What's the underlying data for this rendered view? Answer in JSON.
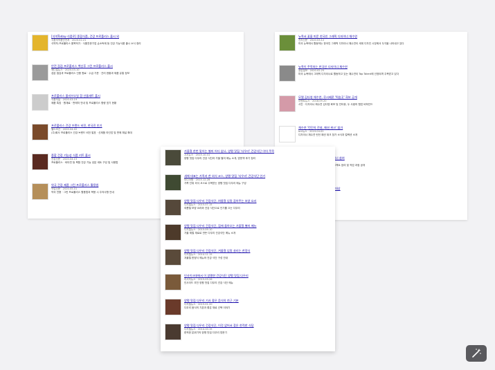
{
  "left": {
    "results": [
      {
        "title": "[식약Today-식품로] 종합식품, 건강 프로폴리스 출시 외",
        "meta": "식품의약품안전처 · 2020.02.21",
        "snip": "식약처-프로폴리스 품목허가 · 식품전문기업 손소독제 등 건강 기능식품 출시 소식 정리",
        "color": "#e4b52c"
      },
      {
        "title": "안전 점검 프로폴리스 백신후 그린 프로폴리스 출시",
        "meta": "메디컬뉴스 · 2020.03.10",
        "snip": "성분 점검과 프로폴리스 인증 원료 · 수급 기준 · 관리 현황과 제품 유통 정보",
        "color": "#9a9a9a"
      },
      {
        "title": "프로폴리스 올리브오일 함 선물세트 출시",
        "meta": "식품저널 · 2020.03.19",
        "snip": "제품 특징 · 원재료 · 판매처 안내 및 프로폴리스 함량 표기 현황",
        "color": "#cccccc"
      },
      {
        "title": "프로폴리스 건강 브랜드 비전, 한국진 인기",
        "meta": "헬스조선 · 2020.04.02",
        "snip": "(주)회사 프로폴리스 건강 브랜드 비전 발표 · 신제품 라인업 및 판매 채널 확대",
        "color": "#7a4a2a"
      },
      {
        "title": "종합 건강 기능성 식품 키트 출시",
        "meta": "건강신문 · 2020.04.15",
        "snip": "프로폴리스 · 비타민 등 복합 건강 기능 성분 세트 구성 및 사용법",
        "color": "#5a2a20"
      },
      {
        "title": "약국 건강 제품 그린 프로폴리스 활용법",
        "meta": "약업신문 · 2020.05.01",
        "snip": "약국 전용 · 그린 프로폴리스 활용법과 복용 시 주의사항 안내",
        "color": "#b58f5a"
      }
    ]
  },
  "right": {
    "results": [
      {
        "title": "뉴욕서 꽃을 피운 한국인 그래픽 디자이너 채수연",
        "meta": "전자신문 · 2020.03.12",
        "snip": "미국 뉴욕에서 활동하는 한국인 그래픽 디자이너 채수연이 세계 디자인 시장에서 두각을 나타내고 있다",
        "color": "#6b8f3a"
      },
      {
        "title": "뉴욕이 주목하는 한국인 디자이너 채수연",
        "meta": "공감일보 · 2020.02.25",
        "snip": "미국 뉴욕에서 그래픽 디자이너로 활동하고 있는 채수연이 Top Talent에 선정되며 주목받고 있다",
        "color": "#8a8a8a"
      },
      {
        "title": "모델 김다영 채수연, 루시베폰 '떡송곳' 화보 공개",
        "meta": "이벤트뉴스 · 2018.09.20",
        "snip": "사진 · 디자이너 채수연 김다영 화보 및 인터뷰, 두 사람의 협업 비하인드",
        "color": "#d49aa8"
      },
      {
        "title": "채수연 '런던의 전설, 패션 위크' 참가",
        "meta": "bnt뉴스 · 2019.04.02",
        "snip": "디자이너 채수연 런던 패션 위크 참가 소식과 컬렉션 소개",
        "color": "#ffffff"
      },
      {
        "title": "채수연 '패러디 릴레이', 디자이너 참여",
        "meta": "bnt뉴스 · 2019.04.02",
        "snip": "디자이너 채수연 패러디 릴레이 프로젝트 참여 및 작업 과정 공개",
        "color": "#ffffff"
      },
      {
        "title": "채수연, 신인 디자이너 공모전 대상",
        "meta": "스타뉴스 · 2019.05.11",
        "snip": "",
        "color": "#ffffff"
      }
    ]
  },
  "center": {
    "results": [
      {
        "title": "가을철 한번 맞이는 별미 어디 없나, 양평 맛집 '다우리' 건강식단 이어 주목",
        "meta": "시사뉴스 · 2015.10.31",
        "snip": "양평 맛집 다우리 건강 식단과 가을 별미 메뉴 소개, 방문객 후기 정리",
        "color": "#4a4a3a"
      },
      {
        "title": "새해 대표는 가족과 한 외식 코스, 양평 맛집 '다우리' 건강식단 인기",
        "meta": "미디어원 · 2015.12.28",
        "snip": "가족 단위 외식 코스로 주목받는 양평 맛집 다우리 메뉴 구성",
        "color": "#3f4a32"
      },
      {
        "title": "양평 맛집 다우리 건강식단, 여름철 입맛 잡아주는 보양 요리",
        "meta": "디지털뉴스 · 2015.07.15",
        "snip": "여름철 보양 요리와 건강 식단으로 인기를 끄는 다우리",
        "color": "#55483a"
      },
      {
        "title": "양평 맛집 다우리 건강식단, 집에 돌아오는 가을철 별미 메뉴",
        "meta": "디지털뉴스 · 2015.09.10",
        "snip": "가을 제철 재료로 만든 다우리 건강식단 메뉴 소개",
        "color": "#4d3a2a"
      },
      {
        "title": "양평 맛집 다우리 건강식단, 겨울철 입맛 살리는 한정식",
        "meta": "디지털뉴스 · 2014.11.15",
        "snip": "겨울철 한정식 메뉴와 건강 식단 구성 안내",
        "color": "#5a4a3a"
      },
      {
        "title": "인사이크데에서 이 양평한 건강식단 양평 맛집 다우리",
        "meta": "리서치뉴스 · 2015.03.26",
        "snip": "인사이드 추천 양평 맛집 다우리 건강 식단 메뉴",
        "color": "#7a5a3a"
      },
      {
        "title": "양평 맛집 다우리 기사 좋은 음식의 친근 기본",
        "meta": "디지털뉴스 · 2015.01.20",
        "snip": "다우리 음식의 기본과 좋은 재료 선택 이야기",
        "color": "#6a3a2a"
      },
      {
        "title": "양평 맛집 다우리 건강식단, 이것 없어서 찾은 한적한 식당",
        "meta": "디지털뉴스 · 2014.10.15",
        "snip": "한적한 분위기의 양평 맛집 다우리 방문기",
        "color": "#4a3a30"
      }
    ]
  },
  "magic_button": {
    "icon": "magic-wand-icon"
  }
}
